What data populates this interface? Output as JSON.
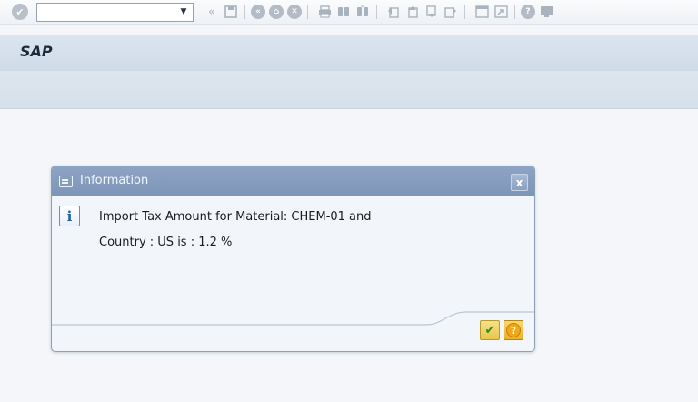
{
  "toolbar": {
    "command_field_value": "",
    "icons": [
      "enter-icon",
      "back-icon",
      "save-icon",
      "back-nav-icon",
      "exit-icon",
      "cancel-icon",
      "print-icon",
      "find-icon",
      "find-next-icon",
      "first-page-icon",
      "previous-page-icon",
      "next-page-icon",
      "last-page-icon",
      "new-session-icon",
      "shortcut-icon",
      "help-icon",
      "customize-layout-icon"
    ]
  },
  "header": {
    "title": "SAP"
  },
  "dialog": {
    "title": "Information",
    "close_label": "x",
    "info_glyph": "i",
    "message_line1": "Import Tax Amount for Material: CHEM-01 and",
    "message_line2": "Country : US is : 1.2 %",
    "ok_glyph": "✔",
    "help_glyph": "?"
  },
  "colors": {
    "title_bar": "#d6e1ec",
    "dialog_header": "#8499bb",
    "ok_check": "#2e8a1c"
  }
}
